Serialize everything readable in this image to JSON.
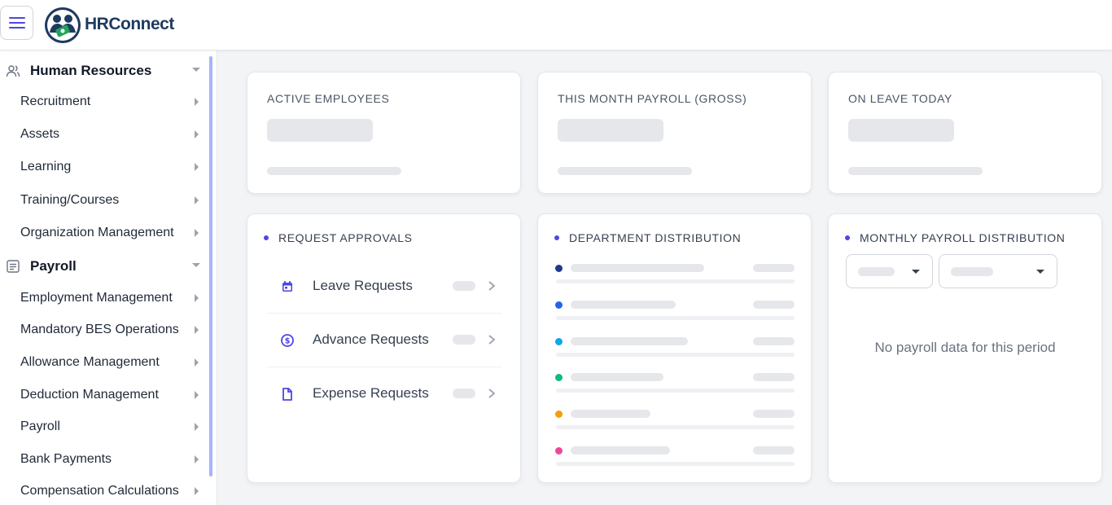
{
  "app": {
    "name": "HRConnect"
  },
  "sidebar": {
    "sections": [
      {
        "label": "Human Resources",
        "icon": "users-icon",
        "items": [
          "Recruitment",
          "Assets",
          "Learning",
          "Training/Courses",
          "Organization Management"
        ]
      },
      {
        "label": "Payroll",
        "icon": "document-icon",
        "items": [
          "Employment Management",
          "Mandatory BES Operations",
          "Allowance Management",
          "Deduction Management",
          "Payroll",
          "Bank Payments",
          "Compensation Calculations"
        ]
      }
    ]
  },
  "stats": {
    "active_employees": {
      "title": "ACTIVE EMPLOYEES"
    },
    "month_payroll": {
      "title": "THIS MONTH PAYROLL (GROSS)"
    },
    "on_leave": {
      "title": "ON LEAVE TODAY"
    }
  },
  "request_approvals": {
    "title": "REQUEST APPROVALS",
    "items": [
      {
        "label": "Leave Requests",
        "icon": "calendar-icon"
      },
      {
        "label": "Advance Requests",
        "icon": "dollar-circle-icon"
      },
      {
        "label": "Expense Requests",
        "icon": "file-icon"
      }
    ]
  },
  "department_distribution": {
    "title": "DEPARTMENT DISTRIBUTION",
    "colors": [
      "#1e3a8a",
      "#2563eb",
      "#0ea5e9",
      "#10b981",
      "#f59e0b",
      "#ec4899"
    ]
  },
  "monthly_payroll": {
    "title": "MONTHLY PAYROLL DISTRIBUTION",
    "empty_message": "No payroll data for this period"
  },
  "theme": {
    "accent": "#4f46e5",
    "brand": "#1e3a5f"
  }
}
